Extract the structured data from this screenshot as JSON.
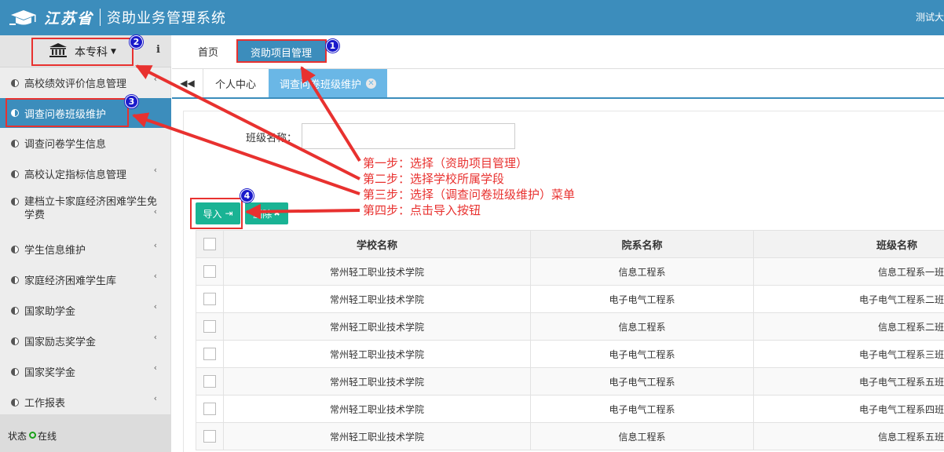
{
  "header": {
    "province": "江苏省",
    "system_name": "资助业务管理系统",
    "user": "测试大"
  },
  "sidebar": {
    "school_level": "本专科",
    "info_label": "i",
    "items": [
      {
        "label": "高校绩效评价信息管理",
        "chevron": "‹"
      },
      {
        "label": "调查问卷班级维护"
      },
      {
        "label": "调查问卷学生信息"
      },
      {
        "label": "高校认定指标信息管理",
        "chevron": "‹"
      },
      {
        "label": "建档立卡家庭经济困难学生免学费",
        "chevron": "‹"
      },
      {
        "label": "学生信息维护",
        "chevron": "‹"
      },
      {
        "label": "家庭经济困难学生库",
        "chevron": "‹"
      },
      {
        "label": "国家助学金",
        "chevron": "‹"
      },
      {
        "label": "国家励志奖学金",
        "chevron": "‹"
      },
      {
        "label": "国家奖学金",
        "chevron": "‹"
      },
      {
        "label": "工作报表",
        "chevron": "‹"
      }
    ],
    "status_label": "状态",
    "status_value": "在线"
  },
  "navbar": {
    "home": "首页",
    "active": "资助项目管理"
  },
  "tabs": {
    "back_icon": "◀◀",
    "items": [
      {
        "label": "个人中心"
      },
      {
        "label": "调查问卷班级维护"
      }
    ],
    "close_glyph": "✕"
  },
  "filter": {
    "label": "班级名称：",
    "value": ""
  },
  "toolbar": {
    "import_label": "导入",
    "import_icon": "⇥",
    "delete_label": "删除",
    "delete_icon": "✖"
  },
  "table": {
    "columns": [
      "学校名称",
      "院系名称",
      "班级名称"
    ],
    "rows": [
      [
        "常州轻工职业技术学院",
        "信息工程系",
        "信息工程系一班"
      ],
      [
        "常州轻工职业技术学院",
        "电子电气工程系",
        "电子电气工程系二班"
      ],
      [
        "常州轻工职业技术学院",
        "信息工程系",
        "信息工程系二班"
      ],
      [
        "常州轻工职业技术学院",
        "电子电气工程系",
        "电子电气工程系三班"
      ],
      [
        "常州轻工职业技术学院",
        "电子电气工程系",
        "电子电气工程系五班"
      ],
      [
        "常州轻工职业技术学院",
        "电子电气工程系",
        "电子电气工程系四班"
      ],
      [
        "常州轻工职业技术学院",
        "信息工程系",
        "信息工程系五班"
      ]
    ]
  },
  "annotations": {
    "color": "#e8312f",
    "badges": [
      "1",
      "2",
      "3",
      "4"
    ],
    "steps": [
      "第一步：选择（资助项目管理）",
      "第二步：选择学校所属学段",
      "第三步：选择（调查问卷班级维护）菜单",
      "第四步：点击导入按钮"
    ]
  },
  "colors": {
    "header_bg": "#3c8dbc",
    "active_tab": "#6ab7e6",
    "button_green": "#1ab394",
    "badge_blue": "#1a1acb"
  }
}
